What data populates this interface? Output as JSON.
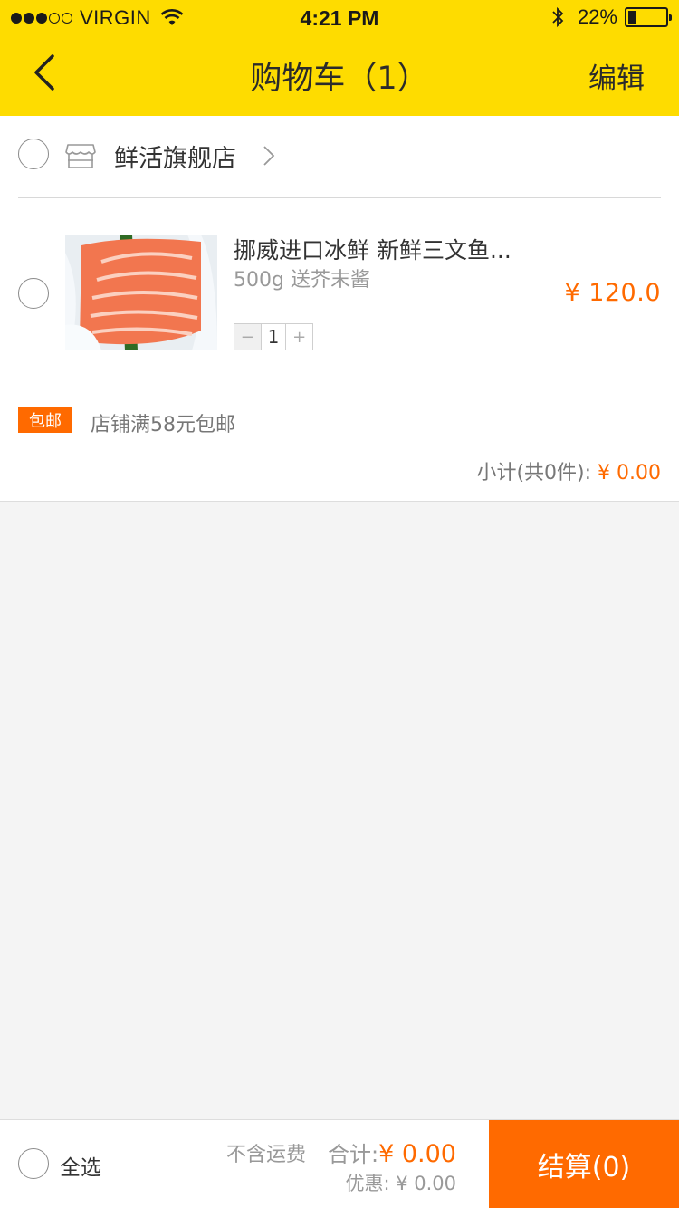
{
  "status_bar": {
    "carrier": "VIRGIN",
    "time": "4:21 PM",
    "battery": "22%",
    "signal_strength": 3,
    "signal_max": 5
  },
  "nav": {
    "title": "购物车（1）",
    "edit_label": "编辑",
    "back_icon": "chevron-left-icon"
  },
  "store": {
    "name": "鲜活旗舰店",
    "icon": "store-icon"
  },
  "product": {
    "name": "挪威进口冰鲜 新鲜三文鱼...",
    "spec": "500g 送芥末酱",
    "price": "¥ 120.0",
    "quantity": "1",
    "minus": "−",
    "plus": "+"
  },
  "shipping": {
    "badge": "包邮",
    "text": "店铺满58元包邮"
  },
  "subtotal": {
    "label": "小计(共0件): ",
    "amount": "¥ 0.00"
  },
  "footer": {
    "select_all": "全选",
    "shipping_note": "不含运费",
    "total_label": "合计:",
    "total_amount": "¥ 0.00",
    "discount": "优惠: ¥ 0.00",
    "checkout": "结算(0)"
  },
  "colors": {
    "brand_yellow": "#fedc00",
    "accent_orange": "#ff6a00",
    "background": "#f4f4f4"
  }
}
